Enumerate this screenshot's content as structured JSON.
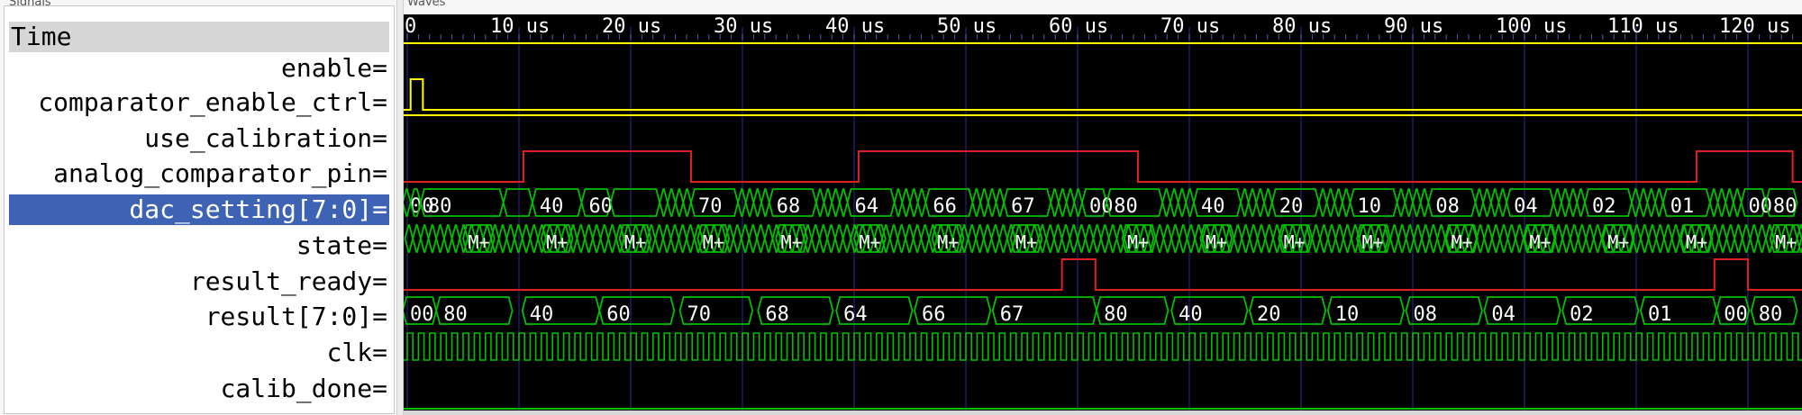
{
  "panes": {
    "signals_label": "Signals",
    "waves_label": "Waves"
  },
  "signals": [
    {
      "id": "time",
      "label": "Time"
    },
    {
      "id": "enable",
      "label": "enable="
    },
    {
      "id": "comparator_enable_ctrl",
      "label": "comparator_enable_ctrl="
    },
    {
      "id": "use_calibration",
      "label": "use_calibration="
    },
    {
      "id": "analog_comparator_pin",
      "label": "analog_comparator_pin="
    },
    {
      "id": "dac_setting",
      "label": "dac_setting[7:0]=",
      "selected": true
    },
    {
      "id": "state",
      "label": "state="
    },
    {
      "id": "result_ready",
      "label": "result_ready="
    },
    {
      "id": "result",
      "label": "result[7:0]="
    },
    {
      "id": "clk",
      "label": "clk="
    },
    {
      "id": "calib_done",
      "label": "calib_done="
    }
  ],
  "timeline": {
    "first_tick_text": "0",
    "ticks": [
      "10 us",
      "20 us",
      "30 us",
      "40 us",
      "50 us",
      "60 us",
      "70 us",
      "80 us",
      "90 us",
      "100 us",
      "110 us",
      "120 us"
    ],
    "visible_range_us": [
      0,
      124
    ],
    "pixels_per_10us": 124
  },
  "colors": {
    "wave_bg": "#000000",
    "digital_1bit": "#ffff00",
    "digital_1bit_alt": "#e02020",
    "bus": "#00c000",
    "bus_text": "#ffffff",
    "grid": "#1c1c6c",
    "ruler_text": "#ffffff"
  },
  "waves": {
    "enable": {
      "type": "bit",
      "color": "digital_1bit",
      "level": "high",
      "transitions_us": []
    },
    "comparator_enable_ctrl": {
      "type": "bit",
      "color": "digital_1bit",
      "level": "low",
      "pulses_us": [
        [
          0.3,
          1.4
        ]
      ]
    },
    "use_calibration": {
      "type": "bit",
      "color": "digital_1bit",
      "level": "high",
      "transitions_us": []
    },
    "analog_comparator_pin": {
      "type": "bit",
      "color": "digital_1bit_alt",
      "level": "low",
      "pulses_us": [
        [
          10.4,
          25.4
        ],
        [
          40.4,
          65.4
        ],
        [
          115.4,
          124
        ]
      ]
    },
    "result_ready": {
      "type": "bit",
      "color": "digital_1bit_alt",
      "level": "low",
      "pulses_us": [
        [
          58.6,
          61.6
        ],
        [
          117,
          120
        ]
      ]
    },
    "dac_setting": {
      "type": "bus",
      "segments": [
        {
          "from": -0.4,
          "to": 0.3,
          "text": "00"
        },
        {
          "from": 0.3,
          "to": 1.2,
          "text": ""
        },
        {
          "from": 1.2,
          "to": 8.6,
          "text": "80"
        },
        {
          "from": 8.6,
          "to": 11.2,
          "text": ""
        },
        {
          "from": 11.2,
          "to": 15.6,
          "text": "40"
        },
        {
          "from": 15.6,
          "to": 18.2,
          "text": "60"
        },
        {
          "from": 18.2,
          "to": 22.6,
          "text": ""
        },
        {
          "from": 25.4,
          "to": 29.6,
          "text": "70"
        },
        {
          "from": 32.4,
          "to": 36.6,
          "text": "68"
        },
        {
          "from": 39.4,
          "to": 43.6,
          "text": "64"
        },
        {
          "from": 46.4,
          "to": 50.6,
          "text": "66"
        },
        {
          "from": 53.4,
          "to": 57.6,
          "text": "67"
        },
        {
          "from": 60.4,
          "to": 62.6,
          "text": "00"
        },
        {
          "from": 62.6,
          "to": 67.6,
          "text": "80"
        },
        {
          "from": 70.4,
          "to": 74.6,
          "text": "40"
        },
        {
          "from": 77.4,
          "to": 81.6,
          "text": "20"
        },
        {
          "from": 84.4,
          "to": 88.6,
          "text": "10"
        },
        {
          "from": 91.4,
          "to": 95.6,
          "text": "08"
        },
        {
          "from": 98.4,
          "to": 102.6,
          "text": "04"
        },
        {
          "from": 105.4,
          "to": 109.6,
          "text": "02"
        },
        {
          "from": 112.4,
          "to": 116.6,
          "text": "01"
        },
        {
          "from": 119.4,
          "to": 121.6,
          "text": "00"
        },
        {
          "from": 121.6,
          "to": 124.4,
          "text": "80"
        }
      ]
    },
    "state": {
      "type": "bus",
      "m_plus_labels_at_us": [
        5.6,
        12.6,
        19.6,
        26.6,
        33.6,
        40.6,
        47.6,
        54.6,
        64.6,
        71.6,
        78.6,
        85.6,
        93.6,
        100.6,
        107.6,
        114.6,
        122.6
      ],
      "label": "M+"
    },
    "result": {
      "type": "bus",
      "segments": [
        {
          "from": -0.4,
          "to": 2.6,
          "text": "00"
        },
        {
          "from": 2.6,
          "to": 9.4,
          "text": "80"
        },
        {
          "from": 10.3,
          "to": 17.2,
          "text": "40"
        },
        {
          "from": 17.2,
          "to": 23.9,
          "text": "60"
        },
        {
          "from": 24.4,
          "to": 30.9,
          "text": "70"
        },
        {
          "from": 31.4,
          "to": 38.1,
          "text": "68"
        },
        {
          "from": 38.4,
          "to": 45.2,
          "text": "64"
        },
        {
          "from": 45.4,
          "to": 52.2,
          "text": "66"
        },
        {
          "from": 52.4,
          "to": 61.7,
          "text": "67"
        },
        {
          "from": 61.7,
          "to": 68.1,
          "text": "80"
        },
        {
          "from": 68.4,
          "to": 75.2,
          "text": "40"
        },
        {
          "from": 75.4,
          "to": 82.2,
          "text": "20"
        },
        {
          "from": 82.4,
          "to": 89.2,
          "text": "10"
        },
        {
          "from": 89.4,
          "to": 96.2,
          "text": "08"
        },
        {
          "from": 96.4,
          "to": 103.2,
          "text": "04"
        },
        {
          "from": 103.4,
          "to": 110.2,
          "text": "02"
        },
        {
          "from": 110.4,
          "to": 117.2,
          "text": "01"
        },
        {
          "from": 117.2,
          "to": 120.1,
          "text": "00"
        },
        {
          "from": 120.3,
          "to": 124.4,
          "text": "80"
        }
      ]
    },
    "clk": {
      "type": "clock",
      "color": "bus",
      "period_us": 1.0
    },
    "calib_done": {
      "type": "bit",
      "color": "bus",
      "level": "low",
      "transitions_us": []
    }
  }
}
